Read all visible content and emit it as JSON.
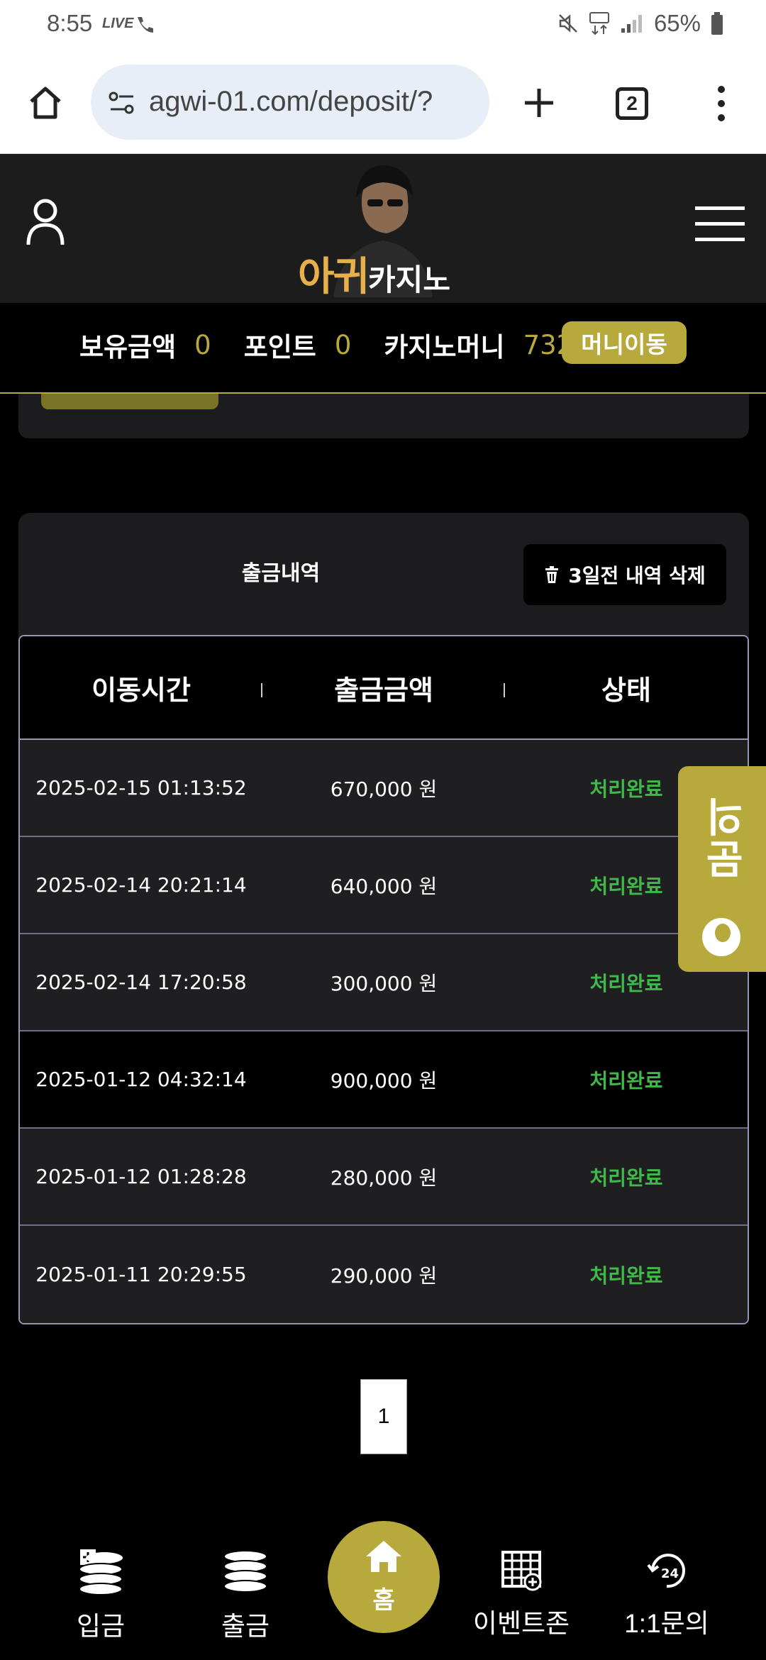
{
  "status_bar": {
    "time": "8:55",
    "live_label": "LIVE",
    "battery": "65%"
  },
  "browser": {
    "url": "agwi-01.com/deposit/?",
    "tab_count": "2"
  },
  "site": {
    "logo_text_main": "아귀",
    "logo_text_sub": "카지노"
  },
  "balance": {
    "holding_label": "보유금액",
    "holding_value": "0",
    "point_label": "포인트",
    "point_value": "0",
    "casino_money_label": "카지노머니",
    "casino_money_value": "732",
    "money_move_button": "머니이동"
  },
  "withdraw": {
    "title": "출금내역",
    "delete_button": "3일전 내역 삭제",
    "columns": [
      "이동시간",
      "출금금액",
      "상태"
    ],
    "rows": [
      {
        "time": "2025-02-15 01:13:52",
        "amount": "670,000 원",
        "status": "처리완료"
      },
      {
        "time": "2025-02-14 20:21:14",
        "amount": "640,000 원",
        "status": "처리완료"
      },
      {
        "time": "2025-02-14 17:20:58",
        "amount": "300,000 원",
        "status": "처리완료"
      },
      {
        "time": "2025-01-12 04:32:14",
        "amount": "900,000 원",
        "status": "처리완료"
      },
      {
        "time": "2025-01-12 01:28:28",
        "amount": "280,000 원",
        "status": "처리완료"
      },
      {
        "time": "2025-01-11 20:29:55",
        "amount": "290,000 원",
        "status": "처리완료"
      }
    ]
  },
  "float_tab": {
    "label": "문의"
  },
  "pagination": {
    "current_page": "1"
  },
  "bottom_nav": {
    "deposit": "입금",
    "withdraw": "출금",
    "home": "홈",
    "event_zone": "이벤트존",
    "inquiry": "1:1문의"
  },
  "colors": {
    "accent": "#b8a93c",
    "status_done": "#3fb94a",
    "card_bg": "#1c1c1e"
  }
}
